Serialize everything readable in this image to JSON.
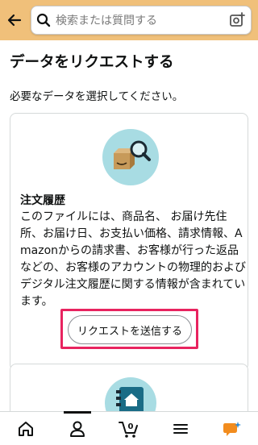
{
  "header": {
    "search_placeholder": "検索または質問する"
  },
  "page": {
    "title": "データをリクエストする",
    "subtitle": "必要なデータを選択してください。"
  },
  "card": {
    "heading": "注文履歴",
    "description": "このファイルには、商品名、 お届け先住所、お届け日、お支払い価格、請求情報、Amazonからの請求書、お客様が行った返品などの、お客様のアカウントの物理的およびデジタル注文履歴に関する情報が含まれています。",
    "button_label": "リクエストを送信する"
  },
  "bottom_nav": {
    "cart_count": "0"
  },
  "colors": {
    "header_bg": "#f0c07a",
    "icon_circle": "#a8dce3",
    "highlight": "#e8235f"
  }
}
